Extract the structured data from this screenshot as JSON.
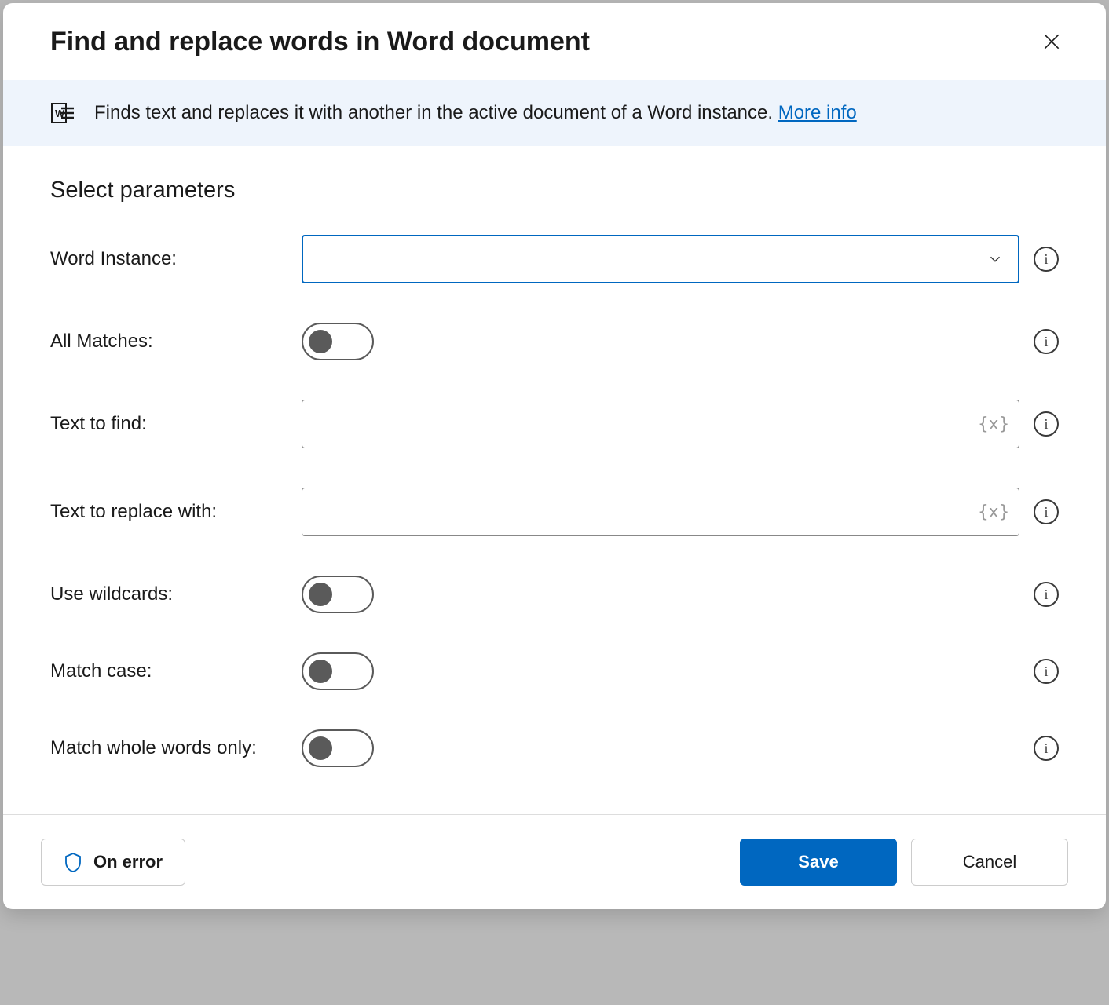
{
  "dialog": {
    "title": "Find and replace words in Word document",
    "banner": {
      "text": "Finds text and replaces it with another in the active document of a Word instance. ",
      "moreInfoLabel": "More info"
    },
    "sectionTitle": "Select parameters",
    "params": {
      "wordInstance": {
        "label": "Word Instance:",
        "value": ""
      },
      "allMatches": {
        "label": "All Matches:",
        "value": false
      },
      "textToFind": {
        "label": "Text to find:",
        "value": ""
      },
      "textToReplaceWith": {
        "label": "Text to replace with:",
        "value": ""
      },
      "useWildcards": {
        "label": "Use wildcards:",
        "value": false
      },
      "matchCase": {
        "label": "Match case:",
        "value": false
      },
      "matchWholeWords": {
        "label": "Match whole words only:",
        "value": false
      }
    },
    "footer": {
      "onErrorLabel": "On error",
      "saveLabel": "Save",
      "cancelLabel": "Cancel"
    }
  }
}
